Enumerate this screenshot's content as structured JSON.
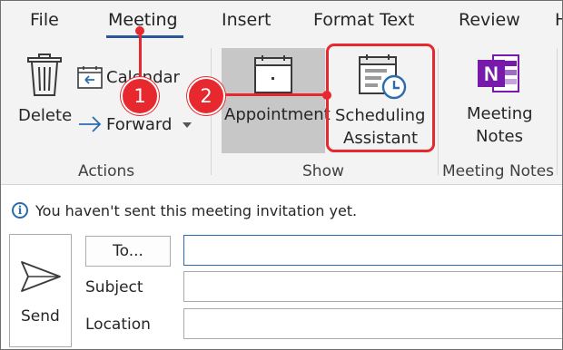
{
  "tabs": [
    {
      "label": "File"
    },
    {
      "label": "Meeting"
    },
    {
      "label": "Insert"
    },
    {
      "label": "Format Text"
    },
    {
      "label": "Review"
    },
    {
      "label": "H"
    }
  ],
  "active_tab": "Meeting",
  "ribbon": {
    "actions": {
      "delete_label": "Delete",
      "calendar_label": "Calendar",
      "forward_label": "Forward",
      "group_label": "Actions"
    },
    "show": {
      "appointment_label": "Appointment",
      "scheduling_line1": "Scheduling",
      "scheduling_line2": "Assistant",
      "group_label": "Show"
    },
    "meeting_notes": {
      "line1": "Meeting",
      "line2": "Notes",
      "group_label": "Meeting Notes"
    }
  },
  "annotations": {
    "badge1": "1",
    "badge2": "2"
  },
  "info_bar": {
    "message": "You haven't sent this meeting invitation yet."
  },
  "form": {
    "send_label": "Send",
    "to_label": "To...",
    "subject_label": "Subject",
    "location_label": "Location",
    "to_value": "",
    "subject_value": "",
    "location_value": ""
  },
  "colors": {
    "accent": "#2b579a",
    "callout": "#e8282f",
    "ribbon_bg": "#f3f3f3",
    "onenote_purple": "#7719aa"
  }
}
